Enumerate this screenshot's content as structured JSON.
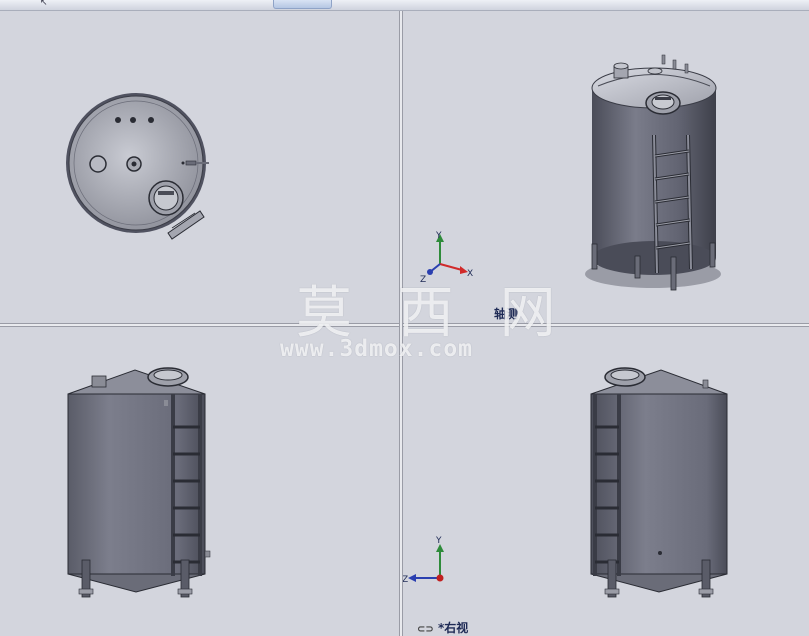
{
  "toolbar": {
    "icons": [
      "zoom-to-fit-icon",
      "zoom-area-icon",
      "previous-view-icon",
      "section-view-icon",
      "view-orientation-icon",
      "display-style-icon",
      "hide-show-items-icon",
      "edit-appearance-icon",
      "apply-scene-icon",
      "view-settings-icon"
    ]
  },
  "viewports": {
    "top_right": {
      "label": "轴测"
    },
    "bottom_right": {
      "label": "*右视"
    }
  },
  "triad": {
    "iso": {
      "y": "Y",
      "x": "X",
      "z": "Z"
    },
    "right": {
      "y": "Y",
      "z": "Z"
    }
  },
  "watermark": {
    "chinese": "莫 西 网",
    "url": "www.3dmox.com"
  },
  "colors": {
    "viewport_bg": "#d3d5dd",
    "tank_body": "#6e707d",
    "triad_y": "#2e8b3a",
    "triad_x": "#d12a2a",
    "triad_z": "#2a3fb0"
  }
}
